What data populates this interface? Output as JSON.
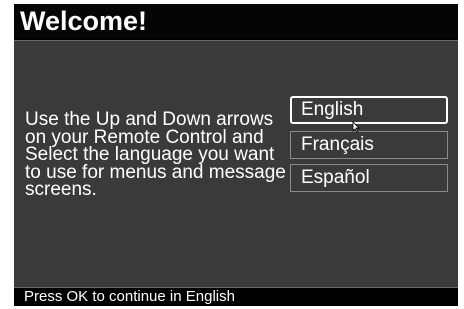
{
  "header": {
    "title": "Welcome!"
  },
  "main": {
    "instructions": "Use the Up and Down arrows on your Remote Control and Select the language you want to use for menus and message screens.",
    "languages": [
      {
        "label": "English",
        "selected": true
      },
      {
        "label": "Français",
        "selected": false
      },
      {
        "label": "Español",
        "selected": false
      }
    ]
  },
  "footer": {
    "status": "Press OK to continue in English"
  },
  "colors": {
    "background": "#000000",
    "panel": "#3a3a3a",
    "text": "#ffffff",
    "selected_border": "#ffffff"
  },
  "icons": {
    "pointer": "mouse-pointer-icon"
  }
}
